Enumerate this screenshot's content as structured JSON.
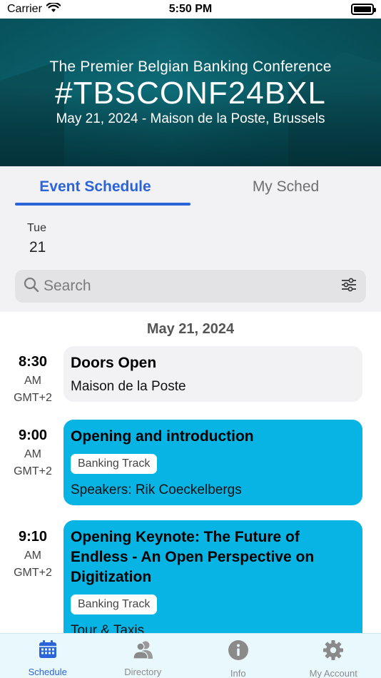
{
  "status_bar": {
    "carrier": "Carrier",
    "time": "5:50 PM"
  },
  "banner": {
    "subtitle": "The Premier Belgian Banking Conference",
    "hashtag": "#TBSCONF24BXL",
    "date_location": "May 21, 2024 - Maison de la Poste, Brussels"
  },
  "tabs": [
    {
      "label": "Event Schedule",
      "active": true
    },
    {
      "label": "My Sched",
      "active": false
    }
  ],
  "day_picker": {
    "day_name": "Tue",
    "day_number": "21"
  },
  "search": {
    "placeholder": "Search"
  },
  "schedule": {
    "date_header": "May 21, 2024",
    "sessions": [
      {
        "time": "8:30",
        "ampm": "AM",
        "tz": "GMT+2",
        "title": "Doors Open",
        "subtitle": "Maison de la Poste",
        "track": ""
      },
      {
        "time": "9:00",
        "ampm": "AM",
        "tz": "GMT+2",
        "title": "Opening and introduction",
        "track": "Banking Track",
        "subtitle": "Speakers: Rik Coeckelbergs"
      },
      {
        "time": "9:10",
        "ampm": "AM",
        "tz": "GMT+2",
        "title": "Opening Keynote: The Future of Endless - An Open Perspective on Digitization",
        "track": "Banking Track",
        "subtitle": "Tour & Taxis"
      }
    ]
  },
  "bottom_nav": [
    {
      "label": "Schedule",
      "icon": "calendar-icon",
      "active": true
    },
    {
      "label": "Directory",
      "icon": "people-icon",
      "active": false
    },
    {
      "label": "Info",
      "icon": "info-icon",
      "active": false
    },
    {
      "label": "My Account",
      "icon": "gear-icon",
      "active": false
    }
  ],
  "colors": {
    "accent": "#2b63d9",
    "card_blue": "#08b4e4",
    "banner_teal": "#127784"
  }
}
